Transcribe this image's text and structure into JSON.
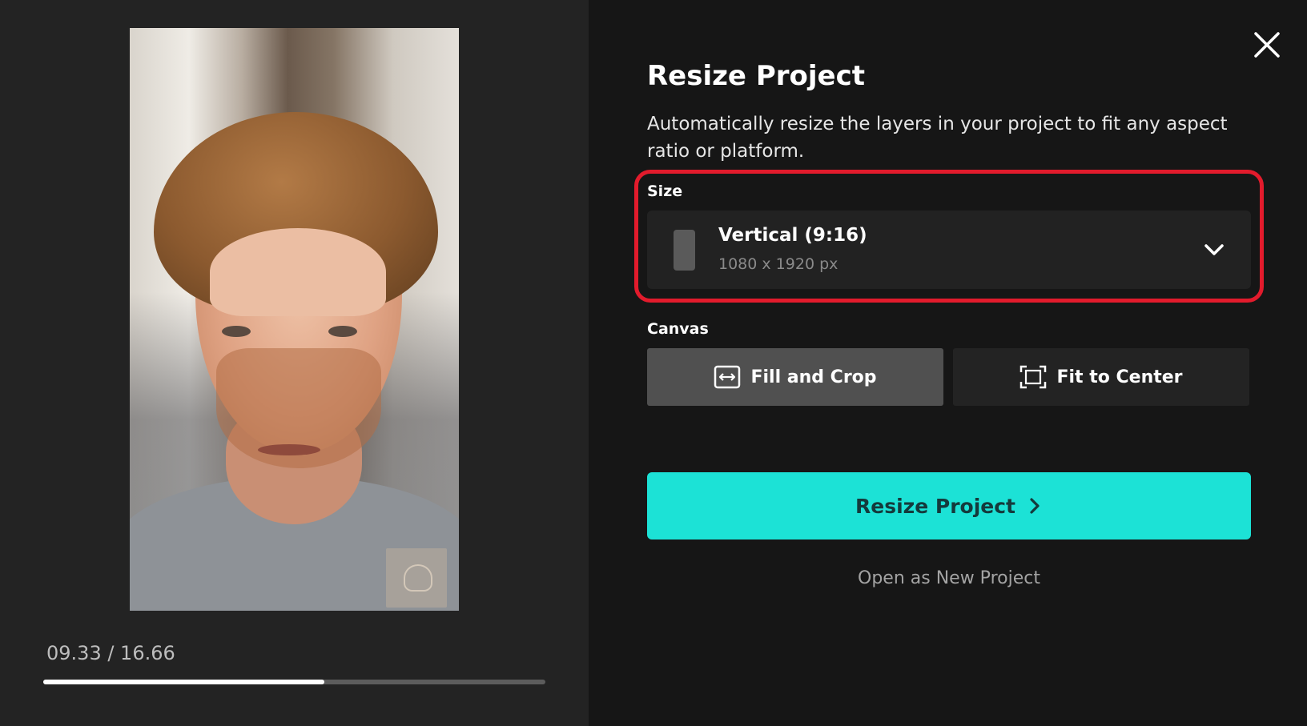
{
  "preview": {
    "timecode": "09.33 / 16.66",
    "progress_fraction": 0.56
  },
  "dialog": {
    "title": "Resize Project",
    "description": "Automatically resize the layers in your project to fit any aspect ratio or platform.",
    "size": {
      "label": "Size",
      "selected_name": "Vertical (9:16)",
      "selected_dims": "1080 x 1920 px"
    },
    "canvas": {
      "label": "Canvas",
      "options": [
        {
          "label": "Fill and Crop",
          "icon": "fill-crop-icon",
          "selected": true
        },
        {
          "label": "Fit to Center",
          "icon": "fit-center-icon",
          "selected": false
        }
      ]
    },
    "primary_button": "Resize Project",
    "secondary_link": "Open as New Project"
  },
  "colors": {
    "accent": "#1ce2d6",
    "highlight": "#e21b2c"
  }
}
